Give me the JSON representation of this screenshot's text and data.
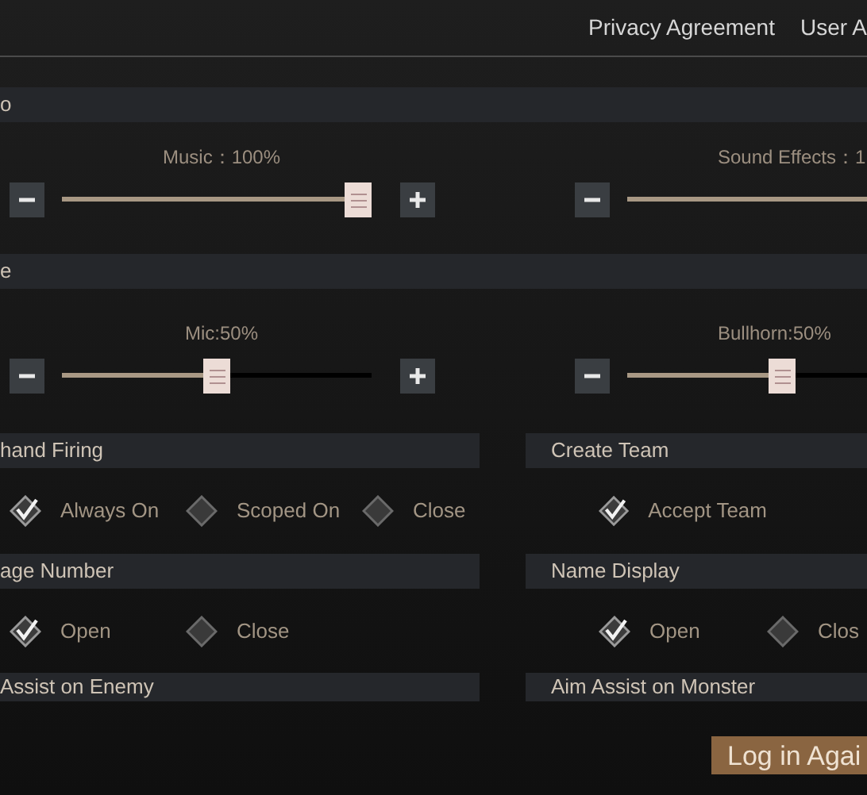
{
  "top_links": [
    "Privacy Agreement",
    "User A"
  ],
  "slider_sections": [
    {
      "title": "o",
      "sliders": [
        {
          "label": "Music：100%",
          "level": 1.0
        },
        {
          "label": "Sound Effects：1"
        }
      ]
    },
    {
      "title": "e",
      "sliders": [
        {
          "label": "Mic:50%",
          "level": 0.5
        },
        {
          "label": "Bullhorn:50%",
          "level": 0.5
        }
      ]
    }
  ],
  "option_rows": [
    {
      "groups": [
        {
          "title": "hand Firing",
          "options": [
            {
              "label": "Always On",
              "selected": true
            },
            {
              "label": "Scoped On",
              "selected": false
            },
            {
              "label": "Close",
              "selected": false
            }
          ]
        },
        {
          "title": "Create Team",
          "options": [
            {
              "label": "Accept Team",
              "selected": true
            }
          ]
        }
      ]
    },
    {
      "groups": [
        {
          "title": "age Number",
          "options": [
            {
              "label": "Open",
              "selected": true
            },
            {
              "label": "Close",
              "selected": false
            }
          ]
        },
        {
          "title": "Name Display",
          "options": [
            {
              "label": "Open",
              "selected": true
            },
            {
              "label": "Clos",
              "selected": false
            }
          ]
        }
      ]
    },
    {
      "groups": [
        {
          "title": "Assist on Enemy"
        },
        {
          "title": "Aim Assist on Monster"
        }
      ]
    }
  ],
  "login_button": "Log in Agai"
}
